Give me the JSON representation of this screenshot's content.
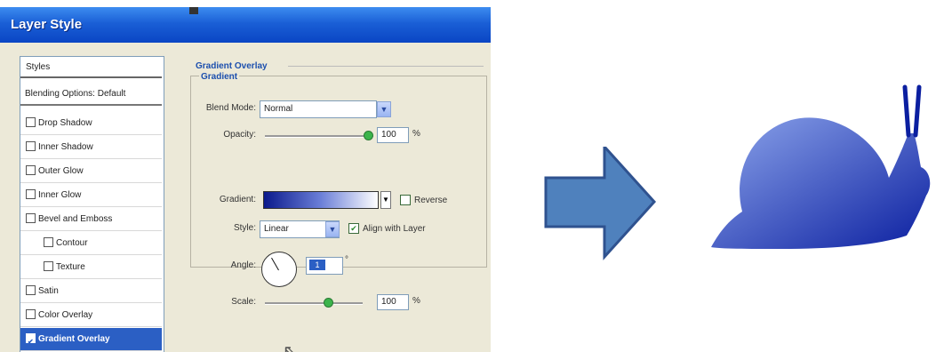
{
  "dialog": {
    "title": "Layer Style",
    "styles_header": "Styles",
    "blending_options": "Blending Options: Default",
    "style_items": [
      {
        "label": "Drop Shadow",
        "checked": false,
        "indent": false
      },
      {
        "label": "Inner Shadow",
        "checked": false,
        "indent": false
      },
      {
        "label": "Outer Glow",
        "checked": false,
        "indent": false
      },
      {
        "label": "Inner Glow",
        "checked": false,
        "indent": false
      },
      {
        "label": "Bevel and Emboss",
        "checked": false,
        "indent": false
      },
      {
        "label": "Contour",
        "checked": false,
        "indent": true
      },
      {
        "label": "Texture",
        "checked": false,
        "indent": true
      },
      {
        "label": "Satin",
        "checked": false,
        "indent": false
      },
      {
        "label": "Color Overlay",
        "checked": false,
        "indent": false
      },
      {
        "label": "Gradient Overlay",
        "checked": true,
        "indent": false,
        "selected": true
      }
    ]
  },
  "gradient_overlay": {
    "section_title": "Gradient Overlay",
    "group_title": "Gradient",
    "blend_mode_label": "Blend Mode:",
    "blend_mode_value": "Normal",
    "opacity_label": "Opacity:",
    "opacity_value": "100",
    "opacity_unit": "%",
    "gradient_label": "Gradient:",
    "reverse_label": "Reverse",
    "style_label": "Style:",
    "style_value": "Linear",
    "align_label": "Align with Layer",
    "angle_label": "Angle:",
    "angle_value": "1",
    "angle_unit": "°",
    "scale_label": "Scale:",
    "scale_value": "100",
    "scale_unit": "%"
  },
  "colors": {
    "title_bar": "#1a5fd6",
    "selection": "#2b5fc4",
    "arrow_fill": "#4f81bd",
    "arrow_stroke": "#2f528f",
    "snail_dark": "#0b1fa0",
    "snail_light": "#8ea6ec"
  }
}
